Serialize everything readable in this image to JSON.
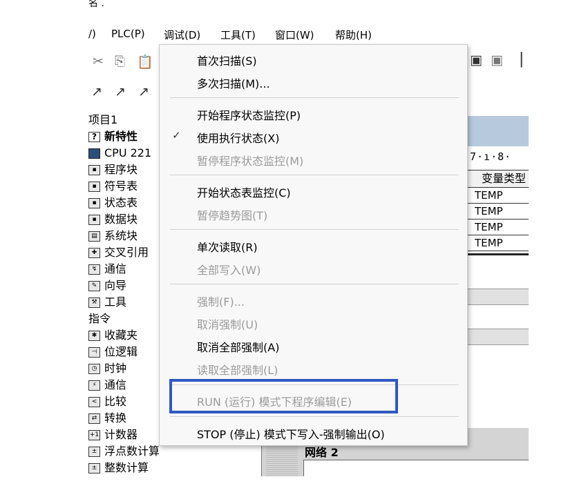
{
  "window_title_fragment": "名 .",
  "menubar": [
    "/) ",
    "PLC(P)",
    "调试(D)",
    "工具(T)",
    "窗口(W)",
    "帮助(H)"
  ],
  "toolbar": {
    "cut": "✂",
    "copy": "⎘",
    "paste": "📋",
    "icon_right_1": "▣",
    "icon_right_2": "▣",
    "icon_right_3": "▏",
    "tool_1": "↗",
    "tool_2": "↗",
    "tool_3": "↗"
  },
  "tree": {
    "project": "项目1",
    "new_features": "新特性",
    "cpu": "CPU 221",
    "program_block": "程序块",
    "symbol_table": "符号表",
    "status_table": "状态表",
    "data_block": "数据块",
    "system_block": "系统块",
    "cross_ref": "交叉引用",
    "comm": "通信",
    "wizard": "向导",
    "tools": "工具",
    "instructions": "指令",
    "favorites": "收藏夹",
    "bit_logic": "位逻辑",
    "clock": "时钟",
    "comm2": "通信",
    "compare": "比较",
    "convert": "转换",
    "counter": "计数器",
    "float_math": "浮点数计算",
    "int_math": "整数计算"
  },
  "right": {
    "ruler": "7·ı·8·",
    "var_type_header": "变量类型",
    "rows": [
      "TEMP",
      "TEMP",
      "TEMP",
      "TEMP"
    ],
    "network": "网络 2"
  },
  "dropdown": {
    "first_scan": "首次扫描(S)",
    "multi_scan": "多次扫描(M)...",
    "start_prog_monitor": "开始程序状态监控(P)",
    "use_exec_status": "使用执行状态(X)",
    "check_mark": "✓",
    "pause_prog_monitor": "暂停程序状态监控(M)",
    "start_table_monitor": "开始状态表监控(C)",
    "pause_trend": "暂停趋势图(T)",
    "single_read": "单次读取(R)",
    "write_all": "全部写入(W)",
    "force": "强制(F)...",
    "unforce": "取消强制(U)",
    "unforce_all": "取消全部强制(A)",
    "read_all_forced": "读取全部强制(L)",
    "run_mode_edit": "RUN (运行) 模式下程序编辑(E)",
    "stop_mode_write": "STOP (停止) 模式下写入-强制输出(O)"
  },
  "colors": {
    "highlight_border": "#2f58c2",
    "disabled_text": "#9b9b9b"
  }
}
